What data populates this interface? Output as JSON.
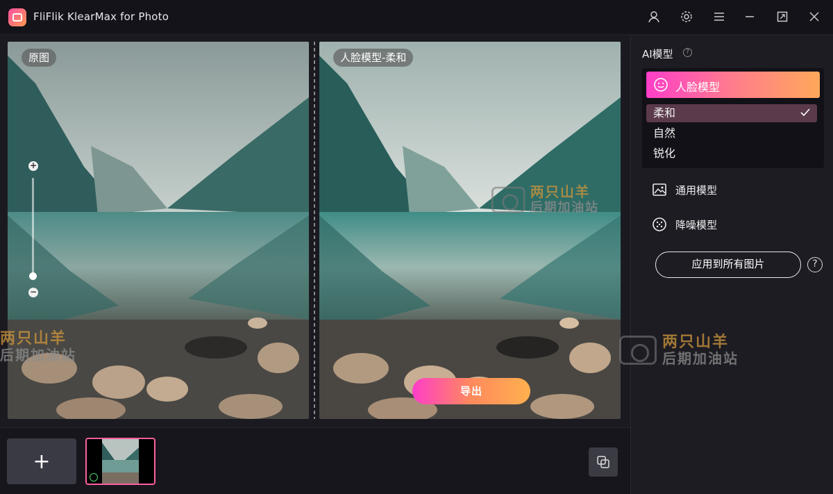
{
  "app": {
    "title": "FliFlik KlearMax for Photo"
  },
  "preview": {
    "left_label": "原图",
    "right_label": "人脸模型-柔和",
    "export_label": "导出"
  },
  "panel": {
    "title": "AI模型",
    "active_model": "人脸模型",
    "sub_options": [
      {
        "label": "柔和",
        "selected": true
      },
      {
        "label": "自然",
        "selected": false
      },
      {
        "label": "锐化",
        "selected": false
      }
    ],
    "models": [
      {
        "label": "通用模型",
        "icon": "image-icon"
      },
      {
        "label": "降噪模型",
        "icon": "noise-icon"
      }
    ],
    "apply_label": "应用到所有图片",
    "help_glyph": "?"
  },
  "watermark": {
    "line1": "两只山羊",
    "line2": "后期加油站"
  },
  "colors": {
    "accent_start": "#ff3ec9",
    "accent_end": "#ffa85a",
    "background": "#17161c"
  }
}
